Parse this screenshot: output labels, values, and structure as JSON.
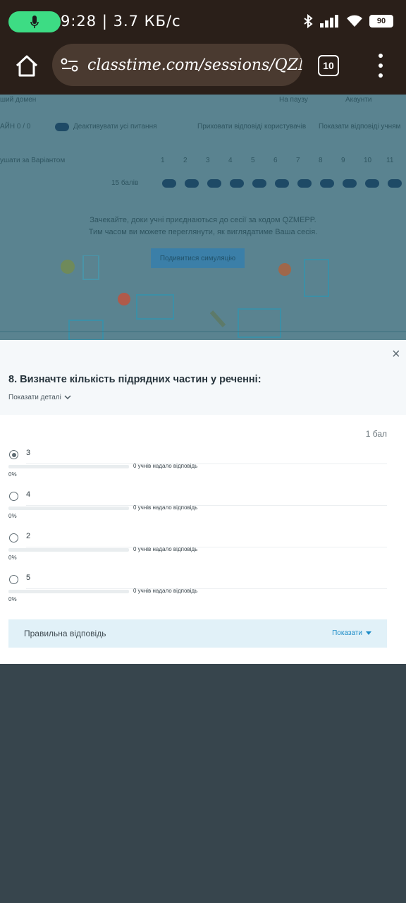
{
  "status_bar": {
    "time": "9:28",
    "speed": "3.7 КБ/с",
    "battery": "90"
  },
  "browser": {
    "url": "classtime.com/sessions/QZME",
    "tab_count": "10"
  },
  "background": {
    "header_left": "ший домен",
    "header_right1": "На паузу",
    "header_right2": "Акаунти",
    "answers_label": "АЙН 0 / 0",
    "deactivate_label": "Деактивувати усі питання",
    "reveal_label": "Приховати відповіді користувачів",
    "reveal_label2": "Показати відповіді учням",
    "variant_label": "ушати за Варіантом",
    "points_label": "15 балів",
    "question_numbers": [
      "1",
      "2",
      "3",
      "4",
      "5",
      "6",
      "7",
      "8",
      "9",
      "10",
      "11"
    ],
    "wait_line1": "Зачекайте, доки учні приєднаються до сесії за кодом QZMEPP.",
    "wait_line2": "Тим часом ви можете переглянути, як виглядатиме Ваша сесія.",
    "preview_button": "Подивитися симуляцію"
  },
  "modal": {
    "question_title": "8. Визначте кількість підрядних частин у реченні:",
    "show_details": "Показати деталі",
    "points": "1 бал",
    "options": [
      {
        "label": "3",
        "count_text": "0 учнів надало відповідь",
        "percent": "0%",
        "fill": 0,
        "selected": true
      },
      {
        "label": "4",
        "count_text": "0 учнів надало відповідь",
        "percent": "0%",
        "fill": 0,
        "selected": false
      },
      {
        "label": "2",
        "count_text": "0 учнів надало відповідь",
        "percent": "0%",
        "fill": 0,
        "selected": false
      },
      {
        "label": "5",
        "count_text": "0 учнів надало відповідь",
        "percent": "0%",
        "fill": 0,
        "selected": false
      }
    ],
    "correct_answer_label": "Правильна відповідь",
    "show_label": "Показати"
  }
}
